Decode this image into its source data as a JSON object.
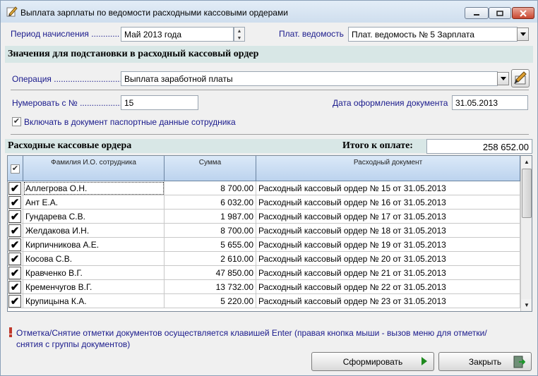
{
  "window": {
    "title": "Выплата зарплаты по ведомости расходными кассовыми ордерами",
    "icon": "pen-document-icon"
  },
  "period": {
    "label": "Период начисления ............",
    "value": "Май 2013 года"
  },
  "statement": {
    "label": "Плат. ведомость",
    "value": "Плат. ведомость № 5 Зарплата"
  },
  "substitution": {
    "heading": "Значения для подстановки в расходный кассовый ордер",
    "operation_label": "Операция .............................",
    "operation_value": "Выплата  заработной платы",
    "numbering_label": "Нумеровать с № ..................",
    "numbering_value": "15",
    "doc_date_label": "Дата оформления документа",
    "doc_date_value": "31.05.2013",
    "passport_label": "Включать в документ паспортные данные сотрудника",
    "passport_checked": true
  },
  "orders": {
    "heading": "Расходные кассовые ордера",
    "total_label": "Итого к оплате:",
    "total_value": "258 652.00",
    "columns": [
      "Фамилия И.О. сотрудника",
      "Сумма",
      "Расходный документ"
    ],
    "rows": [
      {
        "name": "Аллегрова О.Н.",
        "sum": "8 700.00",
        "doc": "Расходный кассовый ордер № 15 от 31.05.2013",
        "checked": true
      },
      {
        "name": "Ант Е.А.",
        "sum": "6 032.00",
        "doc": "Расходный кассовый ордер № 16 от 31.05.2013",
        "checked": true
      },
      {
        "name": "Гундарева С.В.",
        "sum": "1 987.00",
        "doc": "Расходный кассовый ордер № 17 от 31.05.2013",
        "checked": true
      },
      {
        "name": "Желдакова И.Н.",
        "sum": "8 700.00",
        "doc": "Расходный кассовый ордер № 18 от 31.05.2013",
        "checked": true
      },
      {
        "name": "Кирпичникова А.Е.",
        "sum": "5 655.00",
        "doc": "Расходный кассовый ордер № 19 от 31.05.2013",
        "checked": true
      },
      {
        "name": "Косова С.В.",
        "sum": "2 610.00",
        "doc": "Расходный кассовый ордер № 20 от 31.05.2013",
        "checked": true
      },
      {
        "name": "Кравченко В.Г.",
        "sum": "47 850.00",
        "doc": "Расходный кассовый ордер № 21 от 31.05.2013",
        "checked": true
      },
      {
        "name": "Кременчугов В.Г.",
        "sum": "13 732.00",
        "doc": "Расходный кассовый ордер № 22 от 31.05.2013",
        "checked": true
      },
      {
        "name": "Крупицына К.А.",
        "sum": "5 220.00",
        "doc": "Расходный кассовый ордер № 23 от 31.05.2013",
        "checked": true
      }
    ]
  },
  "hint": "Отметка/Снятие отметки документов осуществляется клавишей Enter (правая кнопка мыши - вызов меню для отметки/снятия с группы документов)",
  "buttons": {
    "generate": "Сформировать",
    "close": "Закрыть"
  },
  "colors": {
    "band": "#d8e7e6",
    "label_blue": "#1a1a8c",
    "header_blue": "#bcd3ee"
  }
}
